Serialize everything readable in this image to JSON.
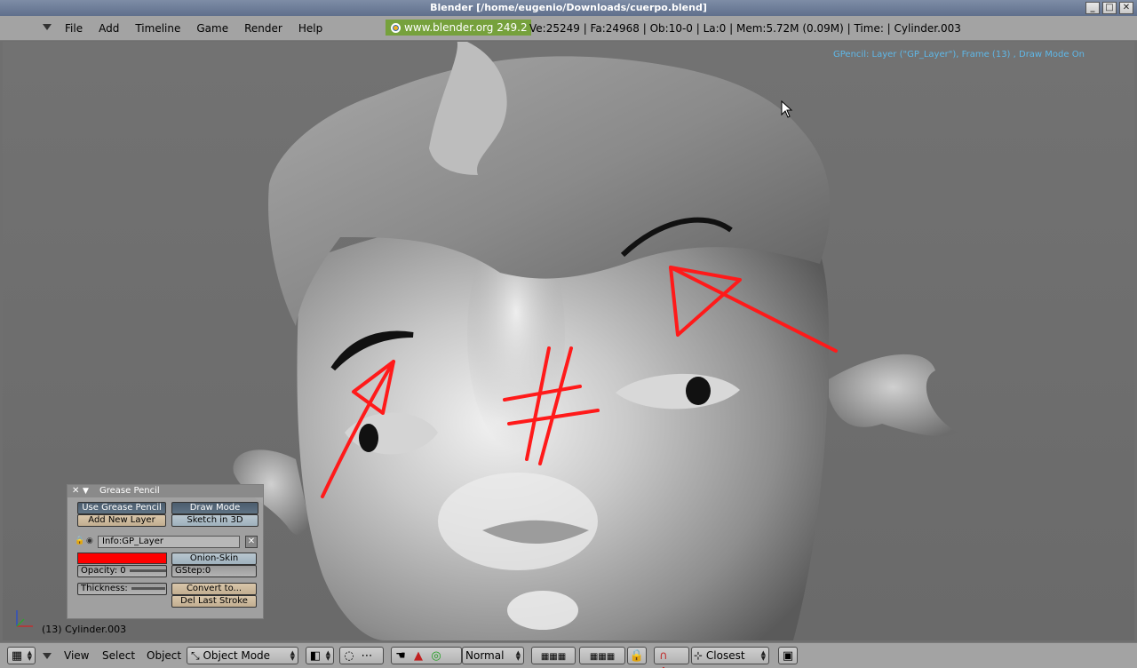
{
  "window": {
    "title": "Blender [/home/eugenio/Downloads/cuerpo.blend]",
    "buttons": [
      "_",
      "□",
      "✕"
    ]
  },
  "header": {
    "menus": [
      "File",
      "Add",
      "Timeline",
      "Game",
      "Render",
      "Help"
    ],
    "brand": "www.blender.org 249.2",
    "stats": "Ve:25249 | Fa:24968 | Ob:10-0 | La:0  | Mem:5.72M (0.09M)  | Time: | Cylinder.003"
  },
  "viewport": {
    "gp_info": "GPencil: Layer (\"GP_Layer\"), Frame (13) , Draw Mode On",
    "object_label": "(13) Cylinder.003"
  },
  "grease_panel": {
    "title": "Grease Pencil",
    "use_grease_pencil": "Use Grease Pencil",
    "draw_mode": "Draw Mode",
    "add_new_layer": "Add New Layer",
    "sketch_in_3d": "Sketch in 3D",
    "layer_name": "Info:GP_Layer",
    "onion_skin": "Onion-Skin",
    "opacity": "Opacity: 0",
    "gstep": "GStep:0",
    "thickness": "Thickness:",
    "convert_to": "Convert to...",
    "del_last_stroke": "Del Last Stroke",
    "stroke_color": "#ff0000"
  },
  "toolbar": {
    "view": "View",
    "select": "Select",
    "object": "Object",
    "mode": "Object Mode",
    "pivot": "Normal",
    "snap": "Closest"
  }
}
